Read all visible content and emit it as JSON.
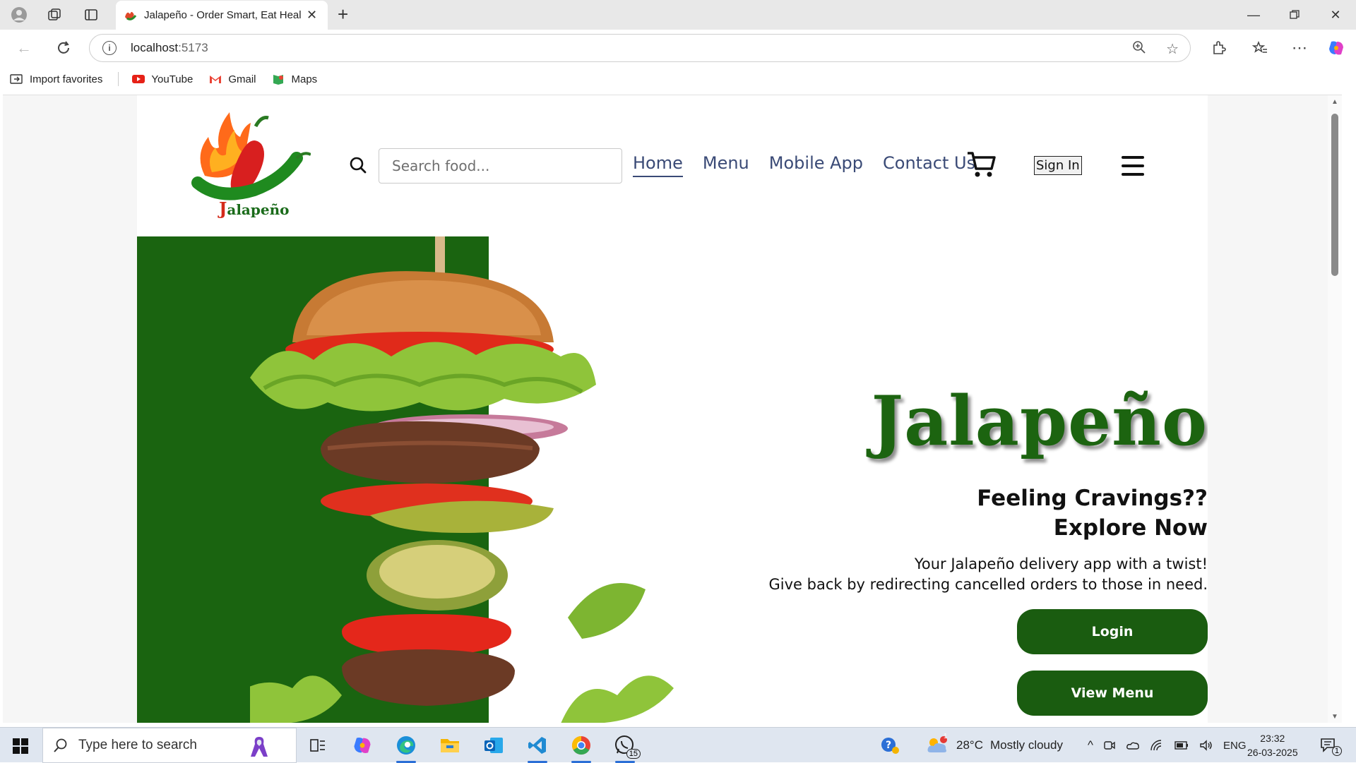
{
  "browser": {
    "tab_title": "Jalapeño - Order Smart, Eat Healt",
    "url_host": "localhost",
    "url_port": ":5173",
    "bookmarks": [
      {
        "label": "Import favorites",
        "icon": "import-icon"
      },
      {
        "label": "YouTube",
        "icon": "youtube-icon"
      },
      {
        "label": "Gmail",
        "icon": "gmail-icon"
      },
      {
        "label": "Maps",
        "icon": "maps-icon"
      }
    ]
  },
  "site": {
    "logo_text": "alapeño",
    "logo_initial": "J",
    "search_placeholder": "Search food...",
    "nav": [
      {
        "label": "Home",
        "active": true
      },
      {
        "label": "Menu",
        "active": false
      },
      {
        "label": "Mobile App",
        "active": false
      },
      {
        "label": "Contact Us",
        "active": false
      }
    ],
    "signin_label": "Sign In",
    "hero": {
      "title": "Jalapeño",
      "sub_line1": "Feeling Cravings??",
      "sub_line2": "Explore Now",
      "desc_line1": "Your Jalapeño delivery app with a twist!",
      "desc_line2": "Give back by redirecting cancelled orders to those in need.",
      "login_label": "Login",
      "viewmenu_label": "View Menu"
    },
    "colors": {
      "brand_green": "#1a6410",
      "nav_text": "#3a4a76"
    }
  },
  "taskbar": {
    "search_placeholder": "Type here to search",
    "weather_temp": "28°C",
    "weather_text": "Mostly cloudy",
    "lang": "ENG",
    "time": "23:32",
    "date": "26-03-2025",
    "whatsapp_badge": "15",
    "weather_badge": "1",
    "notif_count": "1"
  }
}
